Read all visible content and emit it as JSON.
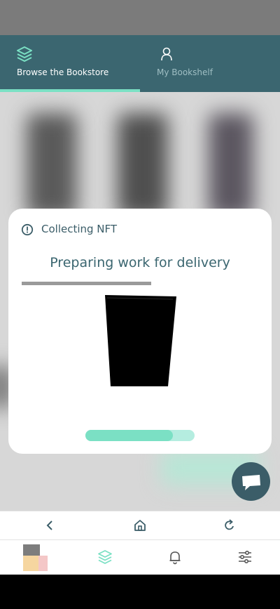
{
  "header": {
    "tabs": [
      {
        "label": "Browse the Bookstore",
        "icon": "layers-icon",
        "active": true
      },
      {
        "label": "My Bookshelf",
        "icon": "person-icon",
        "active": false
      }
    ]
  },
  "modal": {
    "title": "Collecting NFT",
    "heading": "Preparing work for delivery",
    "progress": 0.8
  },
  "browser_bar": {
    "icons": [
      "chevron-left-icon",
      "home-icon",
      "reload-icon"
    ]
  },
  "bottom_nav": {
    "icons": [
      "avatar",
      "layers-icon",
      "bell-icon",
      "sliders-icon"
    ]
  },
  "colors": {
    "header_bg": "#3b6670",
    "accent": "#7be0c4",
    "accent_light": "#b5ede0",
    "text_dark": "#3b5d68",
    "chat_button": "#3b5d68"
  }
}
